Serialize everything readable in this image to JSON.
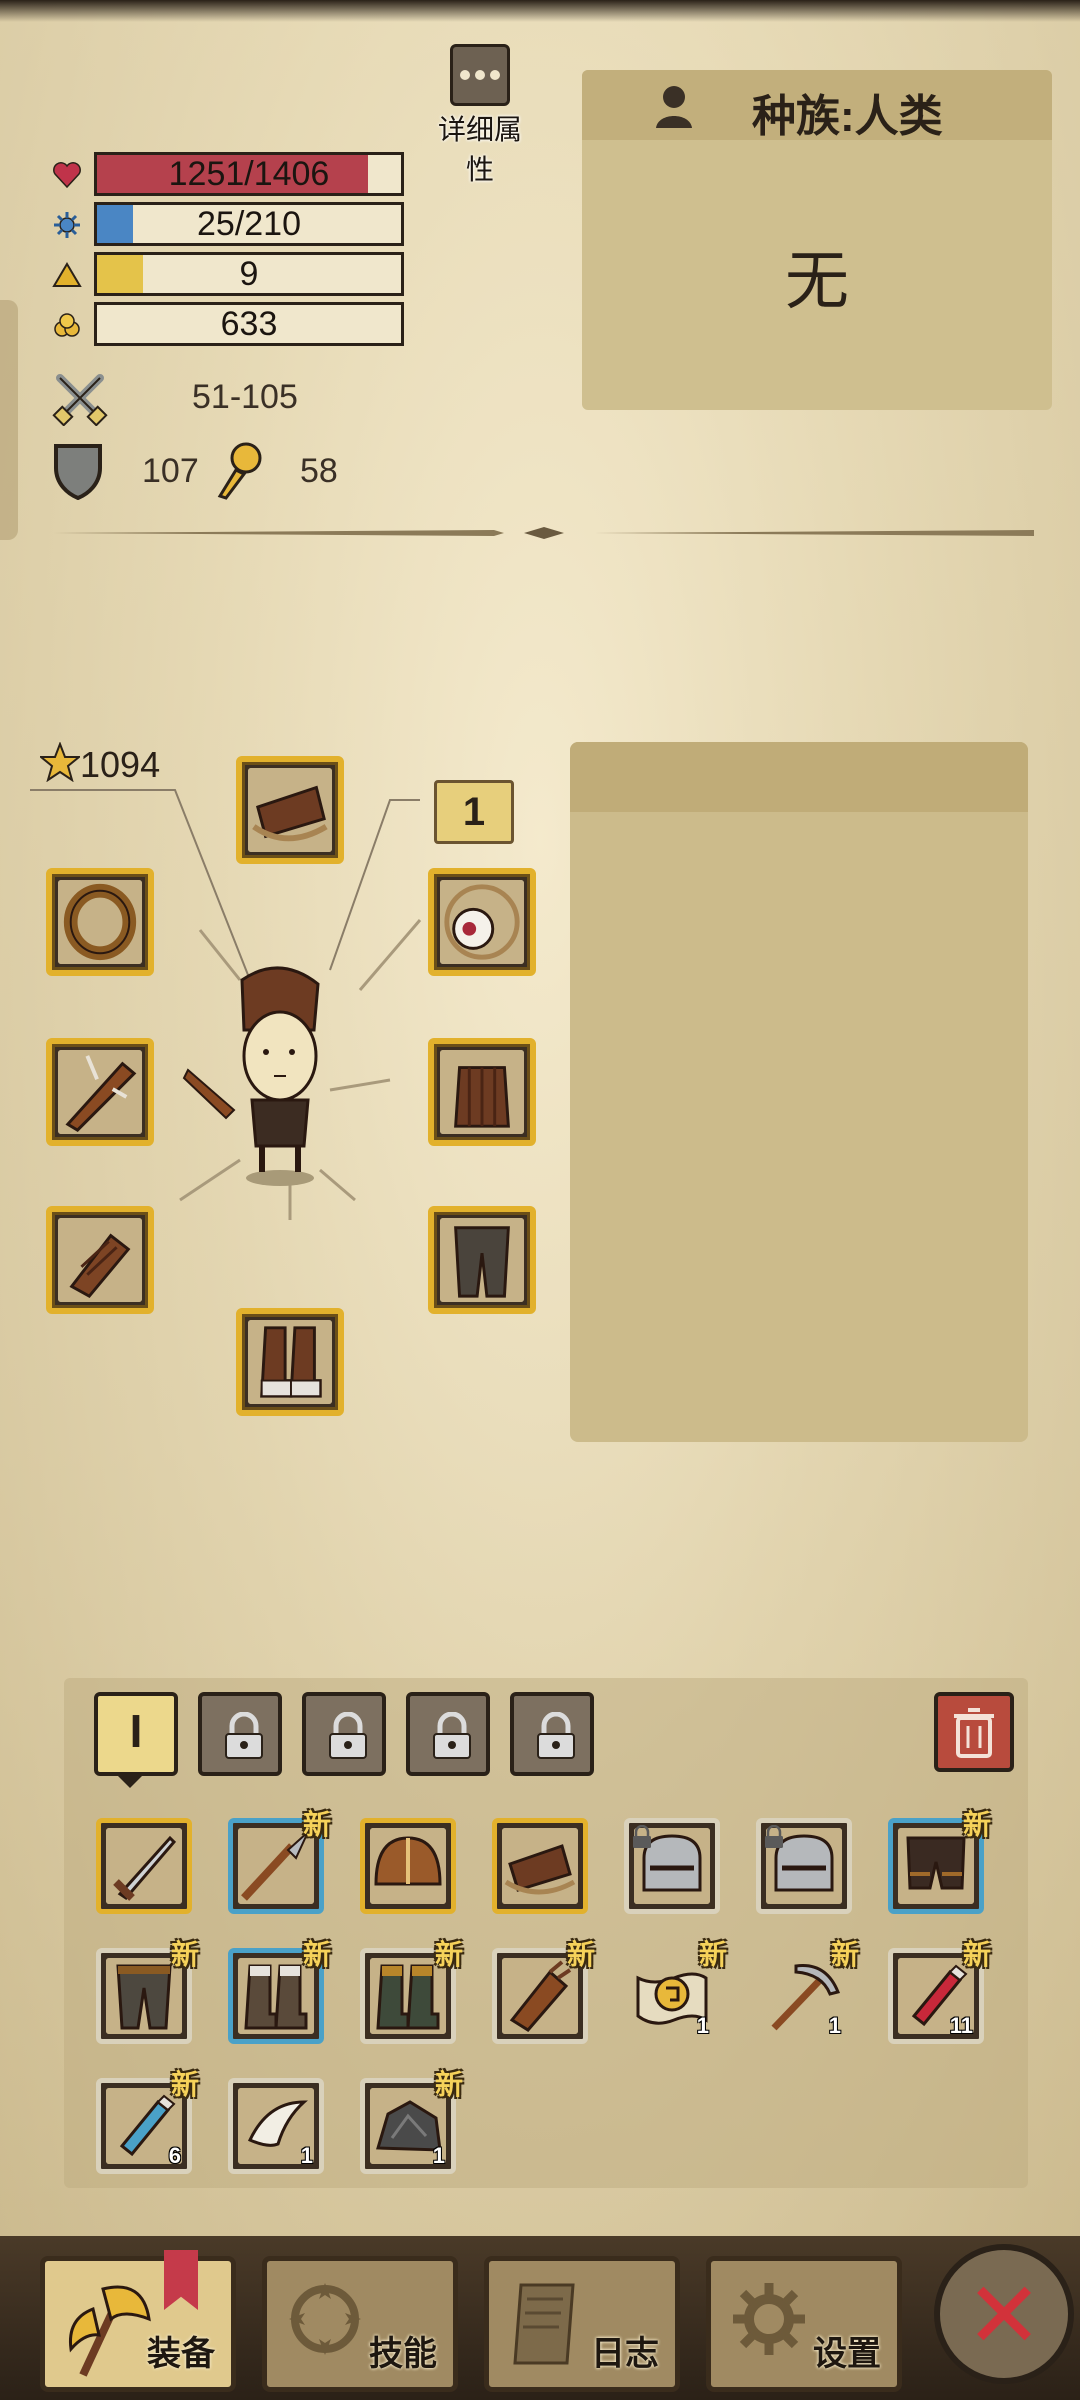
{
  "header": {
    "detail_label": "详细属性"
  },
  "stats": {
    "hp": {
      "text": "1251/1406",
      "fraction": 0.89,
      "color": "#b5414d",
      "icon": "heart-icon"
    },
    "mana": {
      "text": "25/210",
      "fraction": 0.12,
      "color": "#4a86c4",
      "icon": "gear-sparkle-icon"
    },
    "level": {
      "text": "9",
      "fraction": 0.15,
      "color": "#e4c34a",
      "icon": "triangle-icon"
    },
    "gold": {
      "text": "633",
      "fraction": 0.0,
      "color": "#e4c34a",
      "icon": "gold-nugget-icon"
    },
    "attack": "51-105",
    "defense": "107",
    "magic_defense": "58"
  },
  "race": {
    "label": "种族:人类",
    "value": "无"
  },
  "equipment": {
    "score": "1094",
    "level_badge": "1"
  },
  "inventory": {
    "active_tab": "I",
    "items": [
      {
        "name": "sword",
        "new": "",
        "count": "",
        "border": "gold"
      },
      {
        "name": "spear",
        "new": "新",
        "count": "",
        "border": "blue"
      },
      {
        "name": "helmet",
        "new": "",
        "count": "",
        "border": "gold"
      },
      {
        "name": "armor-belt",
        "new": "",
        "count": "",
        "border": "gold"
      },
      {
        "name": "iron-helmet-locked",
        "new": "",
        "count": "",
        "border": "grey"
      },
      {
        "name": "iron-helmet-locked-2",
        "new": "",
        "count": "",
        "border": "grey"
      },
      {
        "name": "shorts",
        "new": "新",
        "count": "",
        "border": "blue"
      },
      {
        "name": "pants",
        "new": "新",
        "count": "",
        "border": "grey"
      },
      {
        "name": "boots-blue",
        "new": "新",
        "count": "",
        "border": "blue"
      },
      {
        "name": "boots",
        "new": "新",
        "count": "",
        "border": "grey"
      },
      {
        "name": "gloves",
        "new": "新",
        "count": "",
        "border": "grey"
      },
      {
        "name": "scroll",
        "new": "新",
        "count": "1",
        "border": "none"
      },
      {
        "name": "pickaxe",
        "new": "新",
        "count": "1",
        "border": "none"
      },
      {
        "name": "red-potion",
        "new": "新",
        "count": "11",
        "border": "grey"
      },
      {
        "name": "blue-potion",
        "new": "新",
        "count": "6",
        "border": "grey"
      },
      {
        "name": "tooth",
        "new": "",
        "count": "1",
        "border": "grey"
      },
      {
        "name": "ore",
        "new": "新",
        "count": "1",
        "border": "grey"
      }
    ]
  },
  "nav": {
    "equip": "装备",
    "skills": "技能",
    "log": "日志",
    "settings": "设置"
  },
  "colors": {
    "gold_border": "#e2b12c",
    "blue_border": "#4aa1c8",
    "close_red": "#d2323a"
  }
}
